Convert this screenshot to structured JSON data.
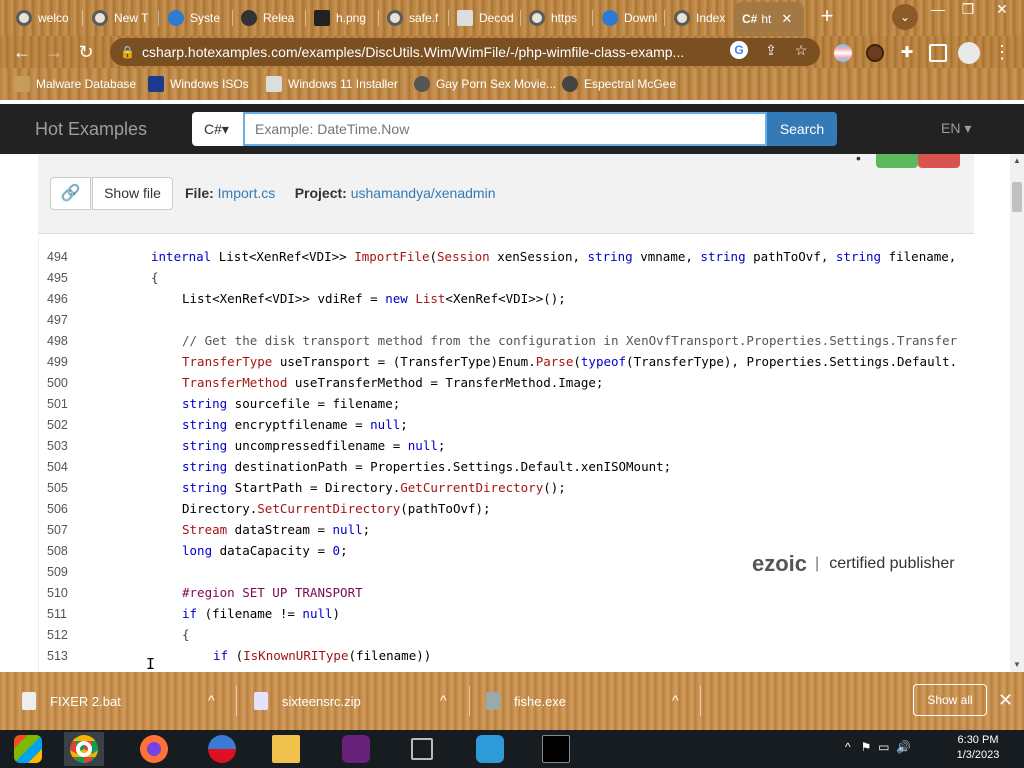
{
  "tabs": [
    {
      "label": "welco",
      "icon": "chrome-icon"
    },
    {
      "label": "New T",
      "icon": "chrome-icon"
    },
    {
      "label": "Syste",
      "icon": "edge-icon"
    },
    {
      "label": "Relea",
      "icon": "github-icon"
    },
    {
      "label": "h.png",
      "icon": "image-icon"
    },
    {
      "label": "safe.f",
      "icon": "chrome-icon"
    },
    {
      "label": "Decod",
      "icon": "document-icon"
    },
    {
      "label": "https",
      "icon": "chrome-icon"
    },
    {
      "label": "Downl",
      "icon": "blue-icon"
    },
    {
      "label": "Index",
      "icon": "chrome-icon"
    },
    {
      "label": "ht",
      "icon": "csharp-icon",
      "favicon_text": "C#",
      "active": true
    }
  ],
  "toolbar": {
    "url": "csharp.hotexamples.com/examples/DiscUtils.Wim/WimFile/-/php-wimfile-class-examp..."
  },
  "bookmarks": [
    {
      "label": "Malware Database"
    },
    {
      "label": "Windows ISOs"
    },
    {
      "label": "Windows 11 Installer"
    },
    {
      "label": "Gay Porn Sex Movie..."
    },
    {
      "label": "Espectral McGee"
    }
  ],
  "site": {
    "brand": "Hot Examples",
    "lang_select": "C#▾",
    "search_placeholder": "Example: DateTime.Now",
    "search_button": "Search",
    "language": "EN ▾"
  },
  "file_panel": {
    "show_file": "Show file",
    "file_label": "File:",
    "file_name": "Import.cs",
    "project_label": "Project:",
    "project_name": "ushamandya/xenadmin"
  },
  "code": {
    "line_numbers": [
      "494",
      "495",
      "496",
      "497",
      "498",
      "499",
      "500",
      "501",
      "502",
      "503",
      "504",
      "505",
      "506",
      "507",
      "508",
      "509",
      "510",
      "511",
      "512",
      "513"
    ]
  },
  "ad": {
    "brand": "ezoic",
    "text": "certified publisher",
    "separator": "|"
  },
  "downloads": [
    {
      "name": "FIXER 2.bat"
    },
    {
      "name": "sixteensrc.zip"
    },
    {
      "name": "fishe.exe"
    }
  ],
  "download_bar": {
    "show_all": "Show all"
  },
  "taskbar": {
    "time": "6:30 PM",
    "date": "1/3/2023"
  }
}
